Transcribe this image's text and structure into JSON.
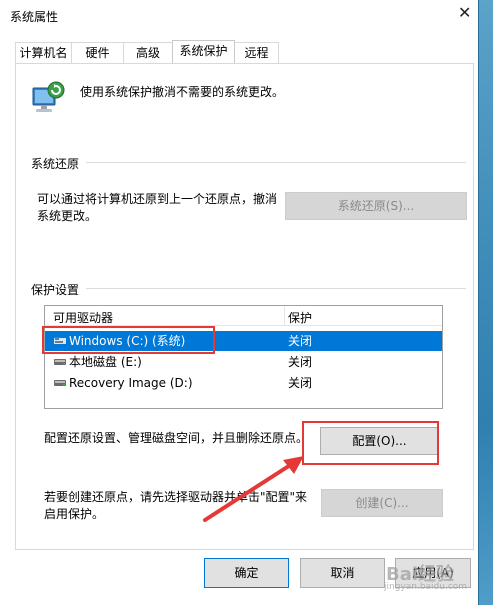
{
  "window": {
    "title": "系统属性",
    "close_glyph": "✕"
  },
  "tabs": [
    {
      "label": "计算机名",
      "active": false
    },
    {
      "label": "硬件",
      "active": false
    },
    {
      "label": "高级",
      "active": false
    },
    {
      "label": "系统保护",
      "active": true
    },
    {
      "label": "远程",
      "active": false
    }
  ],
  "intro_text": "使用系统保护撤消不需要的系统更改。",
  "restore": {
    "title": "系统还原",
    "desc_line1": "可以通过将计算机还原到上一个还原点，撤消",
    "desc_line2": "系统更改。",
    "button_label": "系统还原(S)..."
  },
  "protection": {
    "title": "保护设置",
    "columns": [
      "可用驱动器",
      "保护"
    ],
    "drives": [
      {
        "name": "Windows (C:) (系统)",
        "status": "关闭",
        "selected": true,
        "icon": "windows-drive-icon"
      },
      {
        "name": "本地磁盘 (E:)",
        "status": "关闭",
        "selected": false,
        "icon": "hard-drive-icon"
      },
      {
        "name": "Recovery Image (D:)",
        "status": "关闭",
        "selected": false,
        "icon": "hard-drive-icon"
      }
    ],
    "configure_text": "配置还原设置、管理磁盘空间，并且删除还原点。",
    "configure_button": "配置(O)...",
    "create_text_line1": "若要创建还原点，请先选择驱动器并单击\"配置\"来",
    "create_text_line2": "启用保护。",
    "create_button": "创建(C)..."
  },
  "footer": {
    "ok": "确定",
    "cancel": "取消",
    "apply": "应用(A)"
  },
  "watermark": {
    "text": "Bai经验",
    "sub": "jingyan.baidu.com"
  },
  "colors": {
    "selection": "#0078d7",
    "annotation": "#e53935",
    "disabled_text": "#8a8a8a"
  }
}
